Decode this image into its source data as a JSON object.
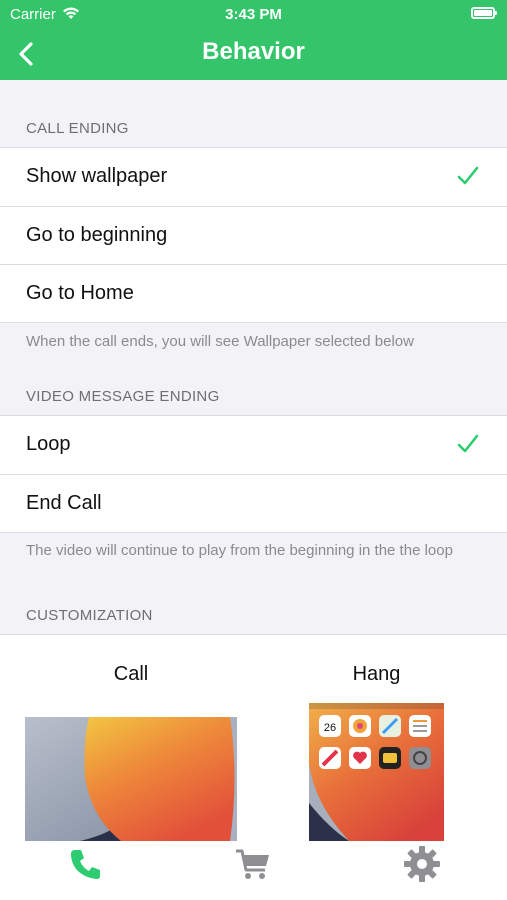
{
  "status_bar": {
    "carrier": "Carrier",
    "time": "3:43 PM"
  },
  "nav": {
    "title": "Behavior"
  },
  "sections": {
    "call_ending": {
      "header": "CALL ENDING",
      "options": [
        {
          "label": "Show wallpaper",
          "selected": true
        },
        {
          "label": "Go to beginning",
          "selected": false
        },
        {
          "label": "Go to Home",
          "selected": false
        }
      ],
      "footer": "When the call ends, you will see Wallpaper selected below"
    },
    "video_message_ending": {
      "header": "VIDEO MESSAGE ENDING",
      "options": [
        {
          "label": "Loop",
          "selected": true
        },
        {
          "label": "End Call",
          "selected": false
        }
      ],
      "footer": "The video will continue to play from the beginning in the the loop"
    },
    "customization": {
      "header": "CUSTOMIZATION",
      "call_label": "Call",
      "hang_label": "Hang",
      "home_date": "26"
    }
  },
  "tabs": [
    {
      "icon": "phone-icon",
      "active": true
    },
    {
      "icon": "cart-icon",
      "active": false
    },
    {
      "icon": "gear-icon",
      "active": false
    }
  ],
  "colors": {
    "accent": "#34c46a",
    "check": "#2ecc71",
    "inactive_tab": "#8e8e93"
  }
}
